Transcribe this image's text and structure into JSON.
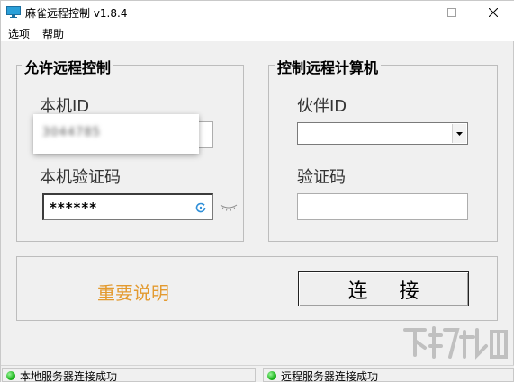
{
  "window": {
    "title": "麻雀远程控制 v1.8.4"
  },
  "menu": {
    "options": "选项",
    "help": "帮助"
  },
  "allow_remote": {
    "legend": "允许远程控制",
    "local_id_label": "本机ID",
    "local_id_value": "3044785",
    "local_code_label": "本机验证码",
    "local_code_value": "******"
  },
  "control_remote": {
    "legend": "控制远程计算机",
    "partner_id_label": "伙伴ID",
    "partner_id_value": "",
    "code_label": "验证码",
    "code_value": ""
  },
  "actions": {
    "important_notes": "重要说明",
    "connect": "连 接"
  },
  "status": {
    "local": "本地服务器连接成功",
    "remote": "远程服务器连接成功"
  },
  "colors": {
    "accent_orange": "#e39a2f",
    "status_green": "#17b317",
    "refresh_blue": "#2f8fd8"
  }
}
